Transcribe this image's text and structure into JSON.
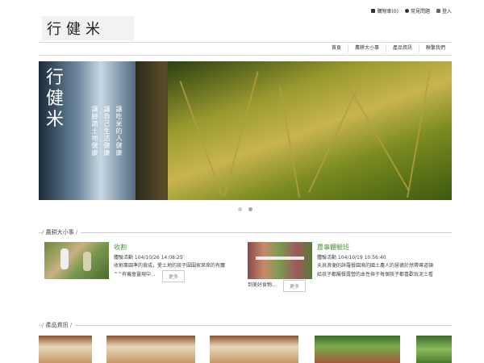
{
  "logo": {
    "text": "行健米"
  },
  "toplinks": {
    "cart": "購物車(0)",
    "faq": "常見問題",
    "login": "登入"
  },
  "nav": [
    "首頁",
    "農耕大小事",
    "產品資訊",
    "聯繫我們"
  ],
  "banner": {
    "title": "行健米",
    "poem": [
      "讓吃米的人健康",
      "讓自己生活健康",
      "讓腳踏土地健康"
    ]
  },
  "sections": {
    "news": "農耕大小事",
    "products": "產品資訊"
  },
  "news": [
    {
      "title": "收割",
      "meta": "體驗活動 104/10/26 14:08:25",
      "desc": "收割事園準的背成，愛土地的孩子圍圍家來來的有鷹",
      "desc2": "^^有機會靈現中...",
      "more": "更多"
    },
    {
      "title": "農事體驗班",
      "meta": "體驗活動 104/10/19 10:56:40",
      "desc": "夭哀滾便的詳羅餐園滌的國土農人的慧德於然帶導道頓",
      "desc2": "給孩子都屬餐露營的本性與于每個孩子都喜歡玩泥土看",
      "desc3": "到美好食物...",
      "more": "更多"
    }
  ],
  "colors": {
    "accent_green": "#4a9a3a",
    "banner_dark": "#3a4020"
  }
}
